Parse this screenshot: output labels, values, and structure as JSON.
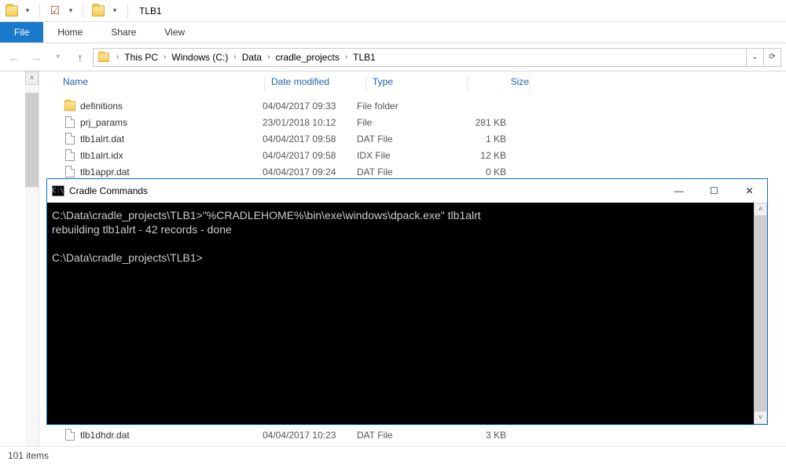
{
  "title": "TLB1",
  "ribbon": {
    "file": "File",
    "home": "Home",
    "share": "Share",
    "view": "View"
  },
  "breadcrumbs": [
    "This PC",
    "Windows (C:)",
    "Data",
    "cradle_projects",
    "TLB1"
  ],
  "columns": {
    "name": "Name",
    "date": "Date modified",
    "type": "Type",
    "size": "Size"
  },
  "rows": [
    {
      "icon": "folder",
      "name": "definitions",
      "date": "04/04/2017 09:33",
      "type": "File folder",
      "size": ""
    },
    {
      "icon": "file",
      "name": "prj_params",
      "date": "23/01/2018 10:12",
      "type": "File",
      "size": "281 KB"
    },
    {
      "icon": "file",
      "name": "tlb1alrt.dat",
      "date": "04/04/2017 09:58",
      "type": "DAT File",
      "size": "1 KB"
    },
    {
      "icon": "file",
      "name": "tlb1alrt.idx",
      "date": "04/04/2017 09:58",
      "type": "IDX File",
      "size": "12 KB"
    },
    {
      "icon": "file",
      "name": "tlb1appr.dat",
      "date": "04/04/2017 09:24",
      "type": "DAT File",
      "size": "0 KB"
    }
  ],
  "rows_below": [
    {
      "icon": "file",
      "name": "tlb1dhdr.dat",
      "date": "04/04/2017 10:23",
      "type": "DAT File",
      "size": "3 KB"
    }
  ],
  "status": "101 items",
  "cmd": {
    "title": "Cradle Commands",
    "line1": "C:\\Data\\cradle_projects\\TLB1>\"%CRADLEHOME%\\bin\\exe\\windows\\dpack.exe\" tlb1alrt",
    "line2": "rebuilding tlb1alrt - 42 records - done",
    "line3": "",
    "line4": "C:\\Data\\cradle_projects\\TLB1>"
  }
}
